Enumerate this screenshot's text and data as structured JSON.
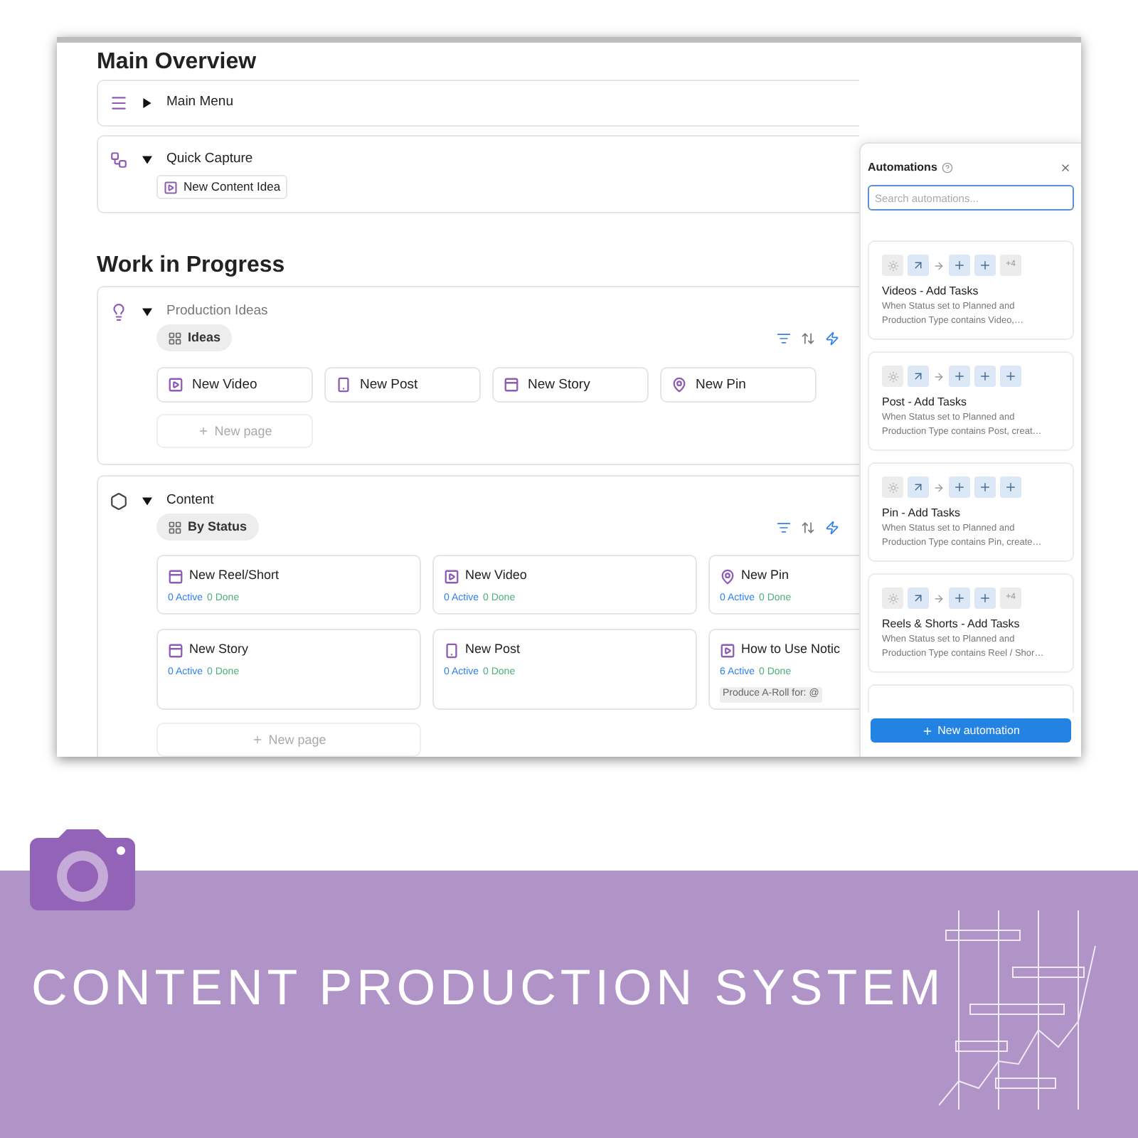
{
  "main_overview": {
    "heading": "Main Overview",
    "main_menu": {
      "title": "Main Menu",
      "expanded": false
    },
    "quick_capture": {
      "title": "Quick Capture",
      "expanded": true,
      "button": "New Content Idea"
    }
  },
  "work_in_progress": {
    "heading": "Work in Progress",
    "production_ideas": {
      "title": "Production Ideas",
      "expanded": true,
      "view": "Ideas",
      "new_page": "New page",
      "cards": [
        {
          "kind": "video",
          "title": "New Video"
        },
        {
          "kind": "post",
          "title": "New Post"
        },
        {
          "kind": "story",
          "title": "New Story"
        },
        {
          "kind": "pin",
          "title": "New Pin"
        }
      ]
    },
    "content": {
      "title": "Content",
      "expanded": true,
      "view": "By Status",
      "new_page": "New page",
      "cards": [
        {
          "kind": "story",
          "title": "New Reel/Short",
          "active": "0 Active",
          "done": "0 Done"
        },
        {
          "kind": "video",
          "title": "New Video",
          "active": "0 Active",
          "done": "0 Done"
        },
        {
          "kind": "pin",
          "title": "New Pin",
          "active": "0 Active",
          "done": "0 Done"
        },
        {
          "kind": "story",
          "title": "New Story",
          "active": "0 Active",
          "done": "0 Done"
        },
        {
          "kind": "post",
          "title": "New Post",
          "active": "0 Active",
          "done": "0 Done"
        },
        {
          "kind": "video",
          "title": "How to Use Notic",
          "active": "6 Active",
          "done": "0 Done",
          "tag": "Produce A-Roll for: @"
        }
      ]
    }
  },
  "automations": {
    "title": "Automations",
    "search_placeholder": "Search automations...",
    "button": "New automation",
    "items": [
      {
        "title": "Videos - Add Tasks",
        "description": "When Status set to Planned and Production Type contains Video,…",
        "steps": [
          {
            "kind": "add"
          },
          {
            "kind": "add"
          }
        ],
        "more": "+4"
      },
      {
        "title": "Post - Add Tasks",
        "description": "When Status set to Planned and Production Type contains Post, creat…",
        "steps": [
          {
            "kind": "add"
          },
          {
            "kind": "add"
          },
          {
            "kind": "add"
          }
        ]
      },
      {
        "title": "Pin - Add Tasks",
        "description": "When Status set to Planned and Production Type contains Pin, create…",
        "steps": [
          {
            "kind": "add"
          },
          {
            "kind": "add"
          },
          {
            "kind": "add"
          }
        ]
      },
      {
        "title": "Reels & Shorts - Add Tasks",
        "description": "When Status set to Planned and Production Type contains Reel / Shor…",
        "steps": [
          {
            "kind": "add"
          },
          {
            "kind": "add"
          }
        ],
        "more": "+4"
      }
    ]
  },
  "banner": {
    "title": "CONTENT PRODUCTION SYSTEM"
  }
}
